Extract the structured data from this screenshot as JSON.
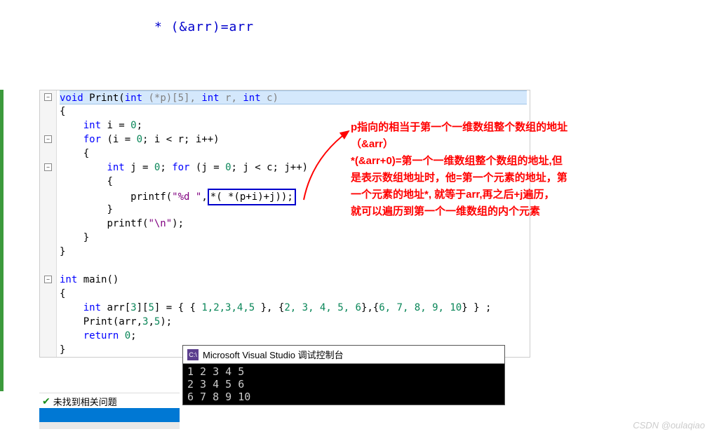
{
  "top_formula": "* (&arr)=arr",
  "code": {
    "l1_kw": "void",
    "l1_fn": " Print",
    "l1_p1": "(",
    "l1_kw2": "int",
    "l1_rest": " (*p)[5], ",
    "l1_kw3": "int",
    "l1_r": " r, ",
    "l1_kw4": "int",
    "l1_c": " c)",
    "l2": "{",
    "l3_sp": "    ",
    "l3_kw": "int",
    "l3_rest": " i = ",
    "l3_num": "0",
    "l3_semi": ";",
    "l4_sp": "    ",
    "l4_kw": "for",
    "l4_p": " (i = ",
    "l4_n1": "0",
    "l4_mid": "; i < r; i++)",
    "l5_sp": "    ",
    "l5": "{",
    "l6_sp": "        ",
    "l6_kw": "int",
    "l6_a": " j = ",
    "l6_n1": "0",
    "l6_b": "; ",
    "l6_kw2": "for",
    "l6_c": " (j = ",
    "l6_n2": "0",
    "l6_d": "; j < c; j++)",
    "l7_sp": "        ",
    "l7": "{",
    "l8_sp": "            ",
    "l8_fn": "printf",
    "l8_p": "(",
    "l8_str": "\"%d \"",
    "l8_comma": ",",
    "l8_box": "*( *(p+i)+j));",
    "l9_sp": "        ",
    "l9": "}",
    "l10_sp": "        ",
    "l10_fn": "printf",
    "l10_p": "(",
    "l10_str": "\"\\n\"",
    "l10_end": ");",
    "l11_sp": "    ",
    "l11": "}",
    "l12": "}",
    "l13": "",
    "l14_kw": "int",
    "l14_fn": " main",
    "l14_p": "()",
    "l15": "{",
    "l16_sp": "    ",
    "l16_kw": "int",
    "l16_a": " arr[",
    "l16_n1": "3",
    "l16_b": "][",
    "l16_n2": "5",
    "l16_c": "] = { { ",
    "l16_nums1": "1,2,3,4,5",
    "l16_d": " }, {",
    "l16_nums2": "2, 3, 4, 5, 6",
    "l16_e": "},{",
    "l16_nums3": "6, 7, 8, 9, 10",
    "l16_f": "} } ;",
    "l17_sp": "    ",
    "l17_fn": "Print",
    "l17_p": "(arr,",
    "l17_n1": "3",
    "l17_c": ",",
    "l17_n2": "5",
    "l17_end": ");",
    "l18_sp": "    ",
    "l18_kw": "return",
    "l18_sp2": " ",
    "l18_n": "0",
    "l18_end": ";",
    "l19": "}"
  },
  "annotation": {
    "line1": "p指向的相当于第一个一维数组整个数组的地址",
    "line2": "（&arr）",
    "line3": "*(&arr+0)=第一个一维数组整个数组的地址,但",
    "line4": "是表示数组地址时，他=第一个元素的地址，第",
    "line5": "一个元素的地址*,  就等于arr,再之后+j遍历，",
    "line6": "就可以遍历到第一个一维数组的内个元素"
  },
  "console": {
    "title": "Microsoft Visual Studio 调试控制台",
    "icon_text": "C:\\",
    "output": "1 2 3 4 5\n2 3 4 5 6\n6 7 8 9 10"
  },
  "status": {
    "text": "未找到相关问题",
    "ghost_icon": "👻"
  },
  "watermark": "CSDN @oulaqiao",
  "fold_minus": "−"
}
